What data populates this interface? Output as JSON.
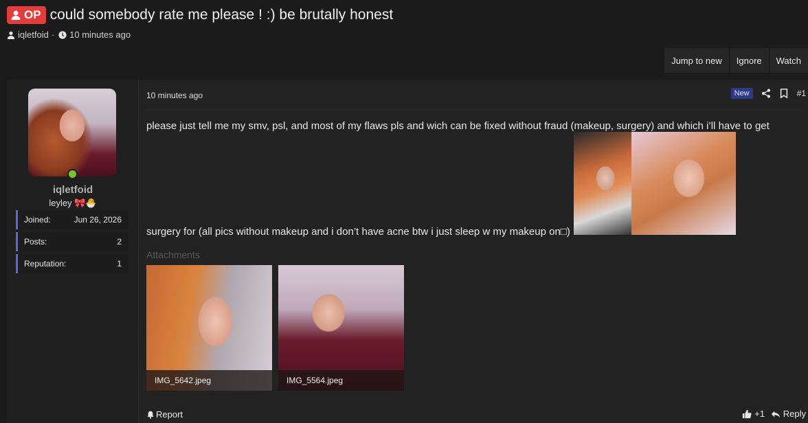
{
  "thread": {
    "op_badge": "OP",
    "title": "could somebody rate me please ! :) be brutally honest",
    "author": "iqletfoid",
    "separator": "·",
    "time": "10 minutes ago"
  },
  "actions": {
    "jump_to_new": "Jump to new",
    "ignore": "Ignore",
    "watch": "Watch"
  },
  "user": {
    "name": "iqletfoid",
    "title": "leyley 🎀🐣",
    "stats": [
      {
        "label": "Joined:",
        "value": "Jun 26, 2026"
      },
      {
        "label": "Posts:",
        "value": "2"
      },
      {
        "label": "Reputation:",
        "value": "1"
      }
    ]
  },
  "post": {
    "date": "10 minutes ago",
    "new_badge": "New",
    "number": "#1",
    "body_line1": "please just tell me my smv, psl, and most of my flaws pls and wich can be fixed without fraud (makeup, surgery) and which i’ll have to get",
    "body_line2": "surgery for (all pics without makeup and i don’t have acne btw i just sleep w my makeup on□)",
    "attachments_label": "Attachments",
    "attachments": [
      {
        "filename": "IMG_5642.jpeg"
      },
      {
        "filename": "IMG_5564.jpeg"
      }
    ],
    "report": "Report",
    "reaction_count": "+1",
    "reply": "Reply"
  },
  "colors": {
    "op_badge": "#e53b3b",
    "new_badge": "#2f3a84",
    "online": "#7cc42a",
    "stat_accent": "#5b6ad0"
  },
  "icons": [
    "user-icon",
    "clock-icon",
    "share-icon",
    "bookmark-icon",
    "bell-icon",
    "thumbs-up-icon",
    "reply-icon"
  ]
}
